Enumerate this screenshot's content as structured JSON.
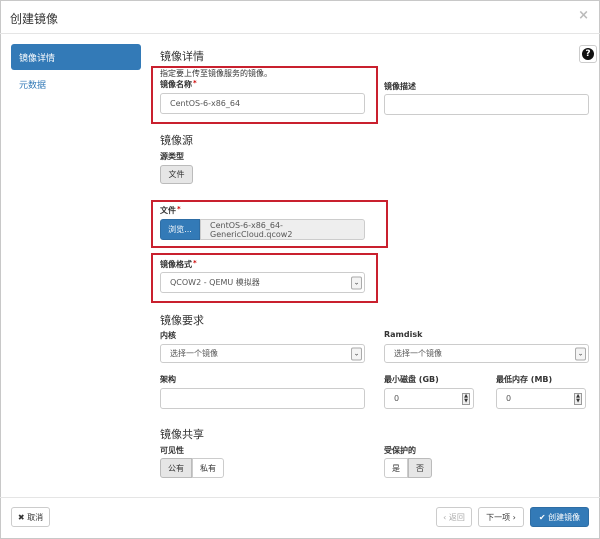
{
  "dialog": {
    "title": "创建镜像",
    "close": "×"
  },
  "sidebar": {
    "items": [
      {
        "label": "镜像详情"
      },
      {
        "label": "元数据"
      }
    ]
  },
  "help": {
    "glyph": "?"
  },
  "details": {
    "heading": "镜像详情",
    "hint": "指定要上传至镜像服务的镜像。",
    "name_label": "镜像名称",
    "name_value": "CentOS-6-x86_64",
    "desc_label": "镜像描述",
    "desc_value": ""
  },
  "source": {
    "heading": "镜像源",
    "type_label": "源类型",
    "type_button": "文件",
    "file_label": "文件",
    "browse_button": "浏览...",
    "file_name": "CentOS-6-x86_64-GenericCloud.qcow2"
  },
  "format": {
    "label": "镜像格式",
    "selected": "QCOW2 - QEMU 模拟器"
  },
  "requirements": {
    "heading": "镜像要求",
    "kernel_label": "内核",
    "kernel_placeholder": "选择一个镜像",
    "ramdisk_label": "Ramdisk",
    "ramdisk_placeholder": "选择一个镜像",
    "arch_label": "架构",
    "arch_value": "",
    "min_disk_label": "最小磁盘 (GB)",
    "min_disk_value": "0",
    "min_ram_label": "最低内存 (MB)",
    "min_ram_value": "0"
  },
  "sharing": {
    "heading": "镜像共享",
    "visibility_label": "可见性",
    "public": "公有",
    "private": "私有",
    "protected_label": "受保护的",
    "yes": "是",
    "no": "否"
  },
  "footer": {
    "cancel": "✖ 取消",
    "back": "‹ 返回",
    "next": "下一项 ›",
    "create": "✔ 创建镜像"
  },
  "colors": {
    "primary": "#337ab7",
    "highlight": "#c9202e"
  }
}
